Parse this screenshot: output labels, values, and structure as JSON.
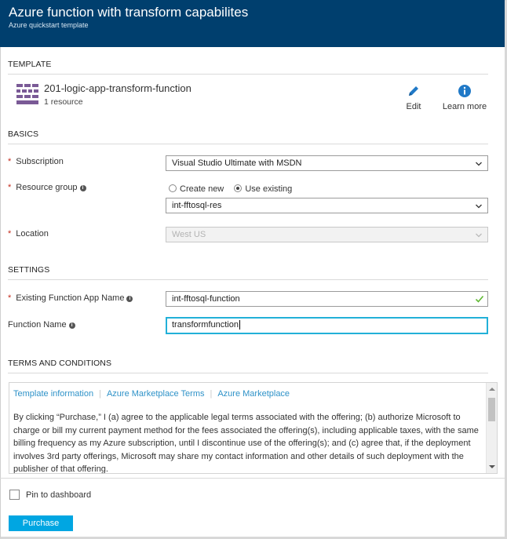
{
  "header": {
    "title": "Azure function with transform capabilites",
    "subtitle": "Azure quickstart template"
  },
  "template": {
    "heading": "TEMPLATE",
    "name": "201-logic-app-transform-function",
    "count": "1 resource",
    "icon": "template-grid-icon",
    "actions": {
      "edit": {
        "label": "Edit",
        "icon": "pencil-icon"
      },
      "learn_more": {
        "label": "Learn more",
        "icon": "info-icon"
      }
    }
  },
  "basics": {
    "heading": "BASICS",
    "subscription": {
      "label": "Subscription",
      "value": "Visual Studio Ultimate with MSDN"
    },
    "resource_group": {
      "label": "Resource group",
      "options": [
        "Create new",
        "Use existing"
      ],
      "selected_option": "Use existing",
      "value": "int-fftosql-res"
    },
    "location": {
      "label": "Location",
      "value": "West US"
    }
  },
  "settings": {
    "heading": "SETTINGS",
    "function_app_name": {
      "label": "Existing Function App Name",
      "value": "int-fftosql-function"
    },
    "function_name": {
      "label": "Function Name",
      "value": "transformfunction"
    }
  },
  "terms": {
    "heading": "TERMS AND CONDITIONS",
    "links": [
      "Template information",
      "Azure Marketplace Terms",
      "Azure Marketplace"
    ],
    "text": "By clicking “Purchase,” I (a) agree to the applicable legal terms associated with the offering; (b) authorize Microsoft to charge or bill my current payment method for the fees associated the offering(s), including applicable taxes, with the same billing frequency as my Azure subscription, until I discontinue use of the offering(s); and (c) agree that, if the deployment involves 3rd party offerings, Microsoft may share my contact information and other details of such deployment with the publisher of that offering."
  },
  "footer": {
    "pin_label": "Pin to dashboard",
    "pin_checked": false,
    "purchase_label": "Purchase"
  },
  "colors": {
    "header_bg": "#003f6e",
    "accent": "#00a6e2",
    "link": "#2e92c8",
    "template_icon": "#7a5a96",
    "focus_border": "#22b0d8",
    "valid_check": "#5fb832",
    "required": "#c42b1c"
  }
}
